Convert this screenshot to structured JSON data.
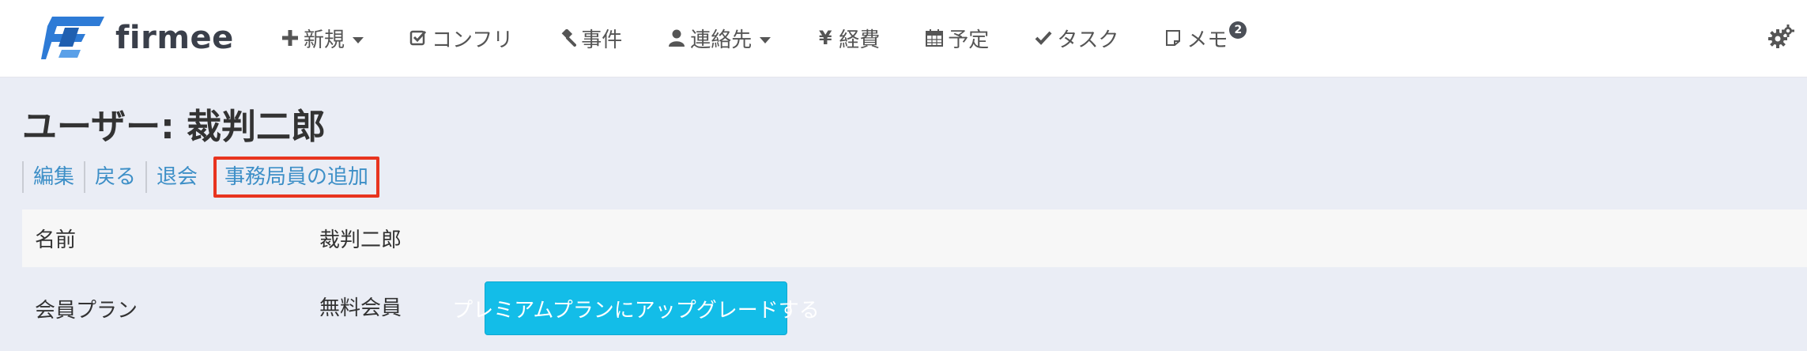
{
  "brand": {
    "name": "firmee",
    "accent": "#2e7bd6"
  },
  "nav": {
    "items": [
      {
        "icon": "plus-icon",
        "label": "新規",
        "dropdown": true
      },
      {
        "icon": "check-square-icon",
        "label": "コンフリ",
        "dropdown": false
      },
      {
        "icon": "gavel-icon",
        "label": "事件",
        "dropdown": false
      },
      {
        "icon": "user-icon",
        "label": "連絡先",
        "dropdown": true
      },
      {
        "icon": "yen-icon",
        "label": "経費",
        "dropdown": false
      },
      {
        "icon": "calendar-icon",
        "label": "予定",
        "dropdown": false
      },
      {
        "icon": "check-icon",
        "label": "タスク",
        "dropdown": false
      },
      {
        "icon": "note-icon",
        "label": "メモ",
        "dropdown": false,
        "badge": "2"
      }
    ],
    "settings_icon": "gears-icon"
  },
  "page": {
    "title": "ユーザー: 裁判二郎",
    "actions": [
      "編集",
      "戻る",
      "退会",
      "事務局員の追加"
    ],
    "highlight_color": "#e8341f"
  },
  "details": {
    "rows": [
      {
        "label": "名前",
        "value": "裁判二郎"
      },
      {
        "label": "会員プラン",
        "value": "無料会員",
        "button": "プレミアムプランにアップグレードする"
      }
    ]
  },
  "colors": {
    "link": "#3d8fc7",
    "button": "#13bde8",
    "background": "#eaedf5"
  }
}
